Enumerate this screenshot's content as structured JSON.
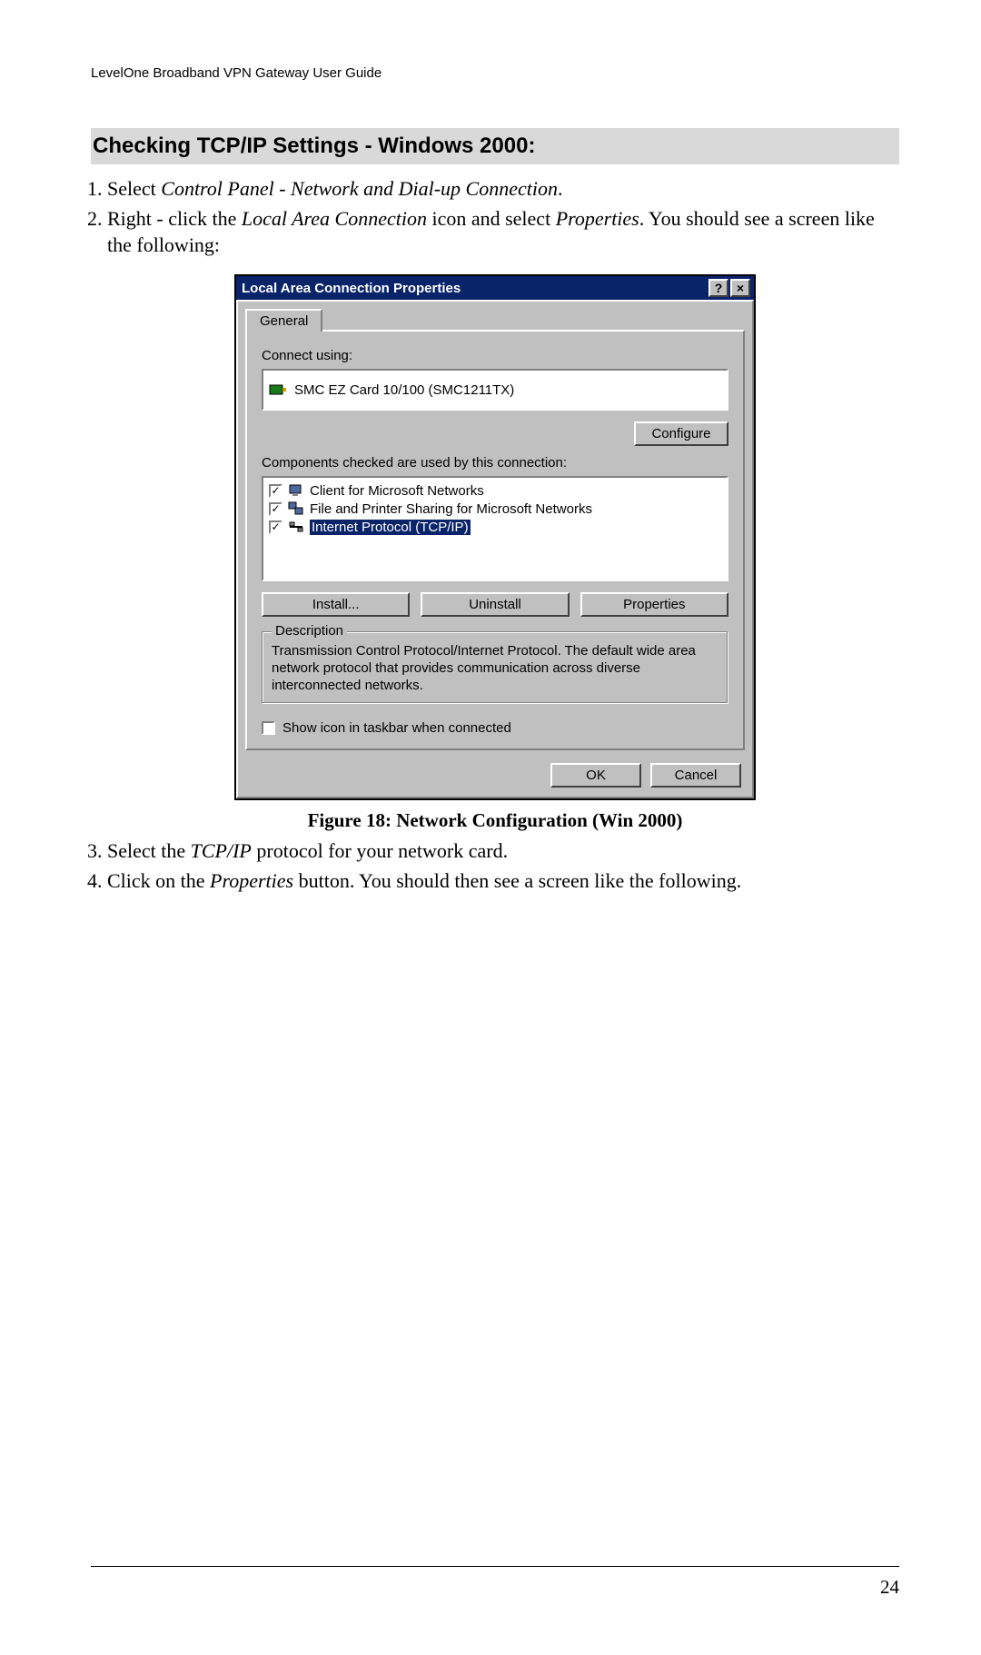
{
  "header": {
    "text": "LevelOne Broadband VPN Gateway User Guide"
  },
  "section": {
    "heading": "Checking TCP/IP Settings - Windows 2000:"
  },
  "steps_a": {
    "s1_prefix": "Select ",
    "s1_italic": "Control Panel - Network and Dial-up Connection",
    "s1_suffix": ".",
    "s2_prefix": "Right - click the ",
    "s2_italic1": "Local Area Connection",
    "s2_mid": " icon and select ",
    "s2_italic2": "Properties",
    "s2_suffix": ". You should see a screen like the following:"
  },
  "dialog": {
    "title": "Local Area Connection Properties",
    "help_glyph": "?",
    "close_glyph": "×",
    "tab_general": "General",
    "connect_using_label": "Connect using:",
    "adapter_name": "SMC EZ Card 10/100 (SMC1211TX)",
    "configure_btn": "Configure",
    "components_label": "Components checked are used by this connection:",
    "components": [
      {
        "label": "Client for Microsoft Networks",
        "checked": "✓",
        "selected": false,
        "icon": "client"
      },
      {
        "label": "File and Printer Sharing for Microsoft Networks",
        "checked": "✓",
        "selected": false,
        "icon": "share"
      },
      {
        "label": "Internet Protocol (TCP/IP)",
        "checked": "✓",
        "selected": true,
        "icon": "protocol"
      }
    ],
    "install_btn": "Install...",
    "uninstall_btn": "Uninstall",
    "properties_btn": "Properties",
    "description_legend": "Description",
    "description_text": "Transmission Control Protocol/Internet Protocol. The default wide area network protocol that provides communication across diverse interconnected networks.",
    "show_icon_label": "Show icon in taskbar when connected",
    "ok_btn": "OK",
    "cancel_btn": "Cancel"
  },
  "figure": {
    "caption": "Figure 18: Network Configuration (Win 2000)"
  },
  "steps_b": {
    "s3_prefix": "Select the ",
    "s3_italic": "TCP/IP",
    "s3_suffix": " protocol for your network card.",
    "s4_prefix": "Click on the ",
    "s4_italic": "Properties",
    "s4_suffix": " button. You should then see a screen like the following."
  },
  "page_number": "24"
}
